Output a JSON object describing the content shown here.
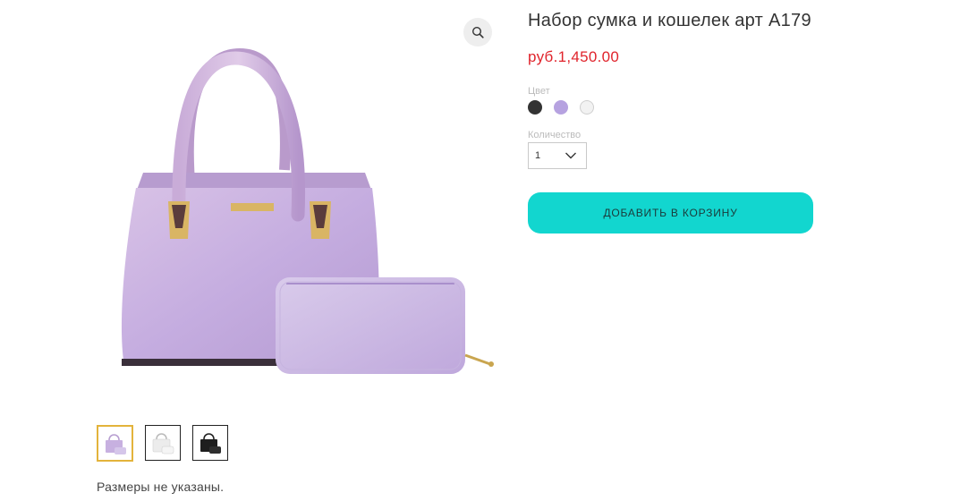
{
  "product": {
    "title": "Набор сумка и кошелек арт A179",
    "price": "руб.1,450.00",
    "color_label": "Цвет",
    "colors": [
      {
        "name": "black",
        "hex": "#333333"
      },
      {
        "name": "lilac",
        "hex": "#b6a2e0"
      },
      {
        "name": "white",
        "hex": "#f2f2f2"
      }
    ],
    "quantity_label": "Количество",
    "quantity_value": "1",
    "add_to_cart_label": "ДОБАВИТЬ В КОРЗИНУ",
    "sizes_note": "Размеры не указаны."
  },
  "gallery": {
    "zoom_icon": "magnifier-icon",
    "thumbnails": [
      {
        "name": "lilac-set",
        "selected": true
      },
      {
        "name": "white-set",
        "selected": false
      },
      {
        "name": "black-set",
        "selected": false
      }
    ]
  },
  "colors": {
    "accent": "#12d6cf",
    "price": "#e0242c",
    "thumb_selected_border": "#e3b33b"
  }
}
